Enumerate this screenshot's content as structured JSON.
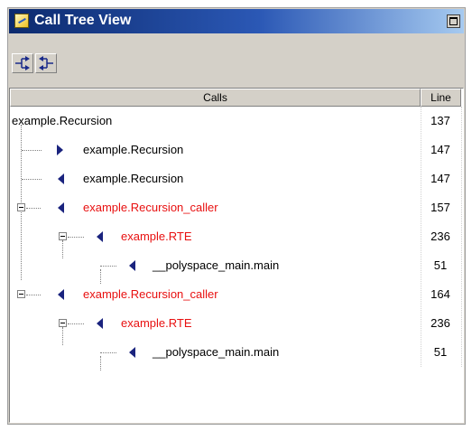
{
  "window": {
    "title": "Call Tree View"
  },
  "toolbar": {
    "buttons": [
      {
        "icon": "expand-callers-icon"
      },
      {
        "icon": "collapse-callees-icon"
      }
    ]
  },
  "table": {
    "columns": [
      "Calls",
      "Line"
    ],
    "rows": [
      {
        "name": "example.Recursion",
        "line": "137",
        "color": "#000000",
        "arrow": "none"
      },
      {
        "name": "example.Recursion",
        "line": "147",
        "color": "#000000",
        "arrow": "right"
      },
      {
        "name": "example.Recursion",
        "line": "147",
        "color": "#000000",
        "arrow": "left"
      },
      {
        "name": "example.Recursion_caller",
        "line": "157",
        "color": "#e81010",
        "arrow": "left"
      },
      {
        "name": "example.RTE",
        "line": "236",
        "color": "#e81010",
        "arrow": "left"
      },
      {
        "name": "__polyspace_main.main",
        "line": "51",
        "color": "#000000",
        "arrow": "left"
      },
      {
        "name": "example.Recursion_caller",
        "line": "164",
        "color": "#e81010",
        "arrow": "left"
      },
      {
        "name": "example.RTE",
        "line": "236",
        "color": "#e81010",
        "arrow": "left"
      },
      {
        "name": "__polyspace_main.main",
        "line": "51",
        "color": "#000000",
        "arrow": "left"
      }
    ]
  }
}
